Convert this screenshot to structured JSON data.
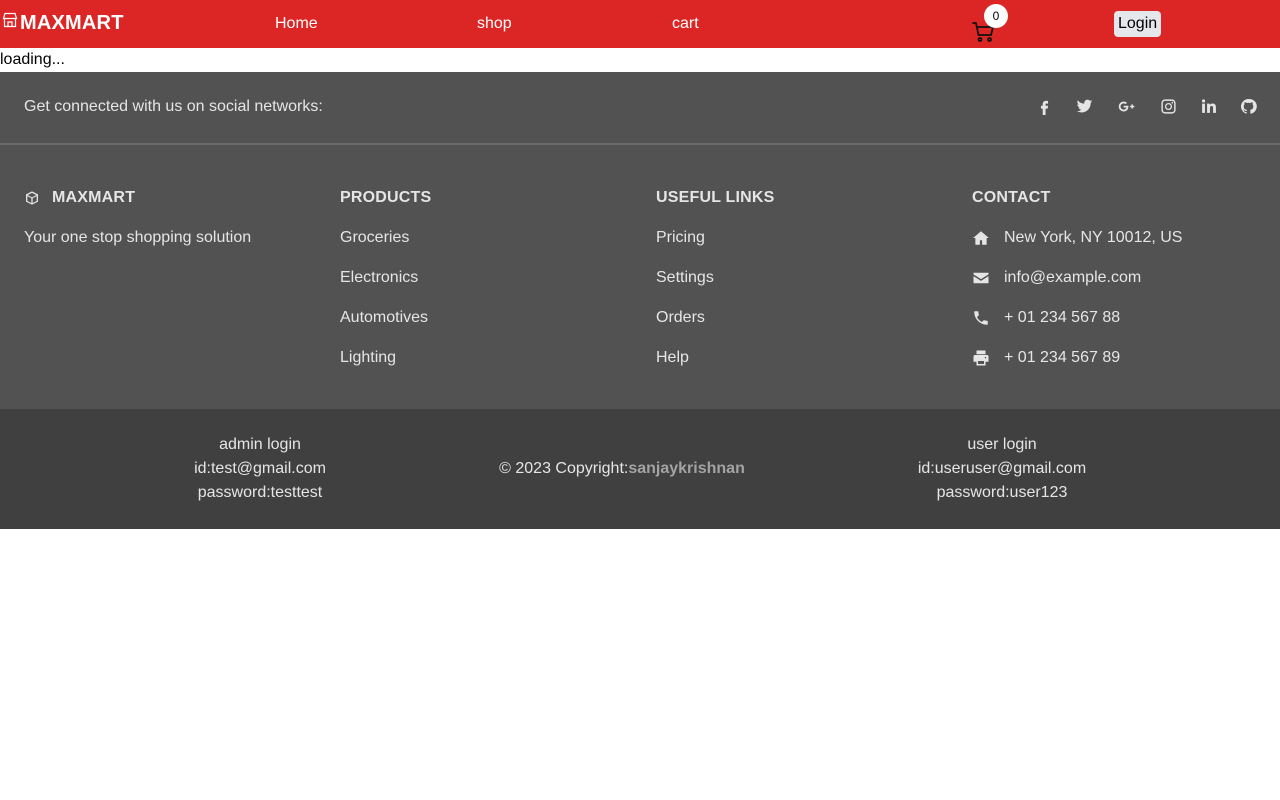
{
  "navbar": {
    "brand": "MAXMART",
    "links": {
      "home": "Home",
      "shop": "shop",
      "cart": "cart"
    },
    "cart_count": "0",
    "login_label": "Login",
    "color": "#dc2626"
  },
  "loading_text": "loading...",
  "social": {
    "text": "Get connected with us on social networks:",
    "icons": [
      "facebook-icon",
      "twitter-icon",
      "google-plus-icon",
      "instagram-icon",
      "linkedin-icon",
      "github-icon"
    ]
  },
  "footer": {
    "brand": {
      "title": "MAXMART",
      "tagline": "Your one stop shopping solution"
    },
    "products": {
      "title": "PRODUCTS",
      "items": [
        "Groceries",
        "Electronics",
        "Automotives",
        "Lighting"
      ]
    },
    "useful_links": {
      "title": "USEFUL LINKS",
      "items": [
        "Pricing",
        "Settings",
        "Orders",
        "Help"
      ]
    },
    "contact": {
      "title": "CONTACT",
      "address": "New York, NY 10012, US",
      "email": "info@example.com",
      "phone": "+ 01 234 567 88",
      "fax": "+ 01 234 567 89"
    }
  },
  "bottom": {
    "admin": {
      "title": "admin login",
      "id": "id:test@gmail.com",
      "password": "password:testtest"
    },
    "copyright_prefix": "© 2023 Copyright:",
    "copyright_name": "sanjaykrishnan",
    "user": {
      "title": "user login",
      "id": "id:useruser@gmail.com",
      "password": "password:user123"
    }
  }
}
